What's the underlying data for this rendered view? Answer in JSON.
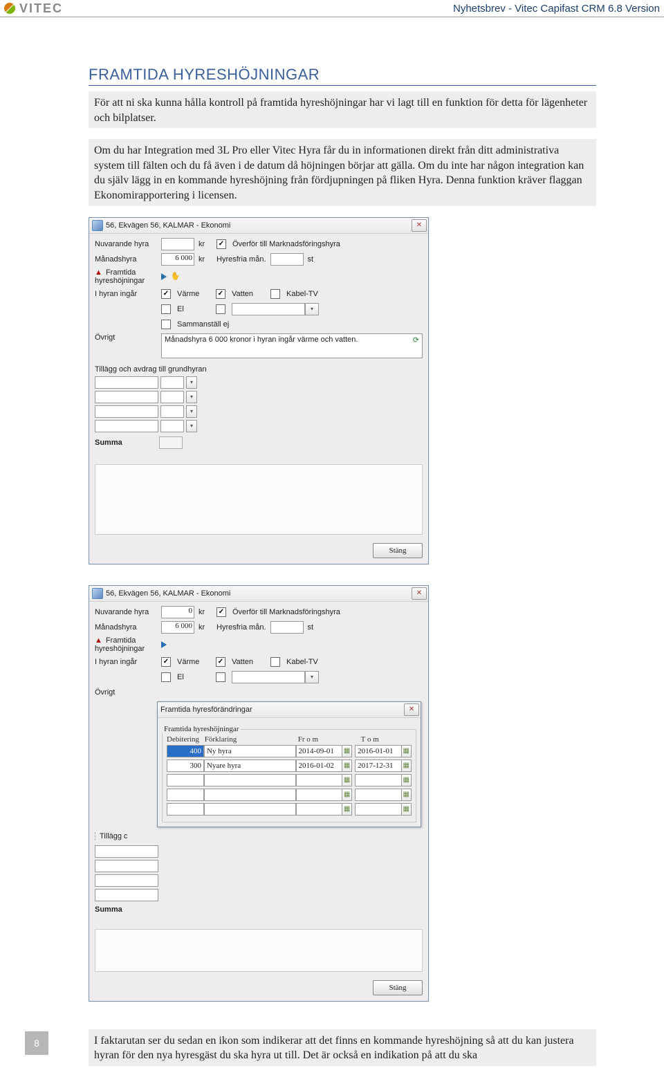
{
  "header": {
    "brand": "VITEC",
    "newsletter_label": "Nyhetsbrev - Vitec Capifast CRM 6.8 Version"
  },
  "article": {
    "section_title": "FRAMTIDA HYRESHÖJNINGAR",
    "p1": "För att ni ska kunna hålla kontroll på framtida hyreshöjningar har vi lagt till en funktion för detta för lägenheter och bilplatser.",
    "p2": "Om du har Integration med 3L Pro eller Vitec Hyra får du in informationen direkt från ditt administrativa system till fälten och du få även i de datum då höjningen börjar att gälla. Om du inte har någon integration kan du själv lägg in en kommande hyreshöjning från fördjupningen på fliken Hyra. Denna funktion kräver flaggan Ekonomirapportering i licensen.",
    "p3": "I faktarutan ser du sedan en ikon som indikerar att det finns en kommande hyreshöjning så att du kan justera hyran för den nya hyresgäst du ska hyra ut till. Det är också en indikation på att du ska"
  },
  "dialog1": {
    "title": "56, Ekvägen 56, KALMAR - Ekonomi",
    "labels": {
      "nuvarande": "Nuvarande hyra",
      "kr": "kr",
      "overfor": "Överför till Marknadsföringshyra",
      "manadshyra": "Månadshyra",
      "manads_value": "6 000",
      "hyresfria": "Hyresfria mån.",
      "st": "st",
      "framtida": "Framtida hyreshöjningar",
      "ihyran": "I hyran ingår",
      "varme": "Värme",
      "vatten": "Vatten",
      "kabeltv": "Kabel-TV",
      "el": "El",
      "sammanstall": "Sammanställ ej",
      "ovrigt": "Övrigt",
      "ovrigt_text": "Månadshyra 6 000 kronor i hyran ingår värme och vatten.",
      "tillagg": "Tillägg och avdrag till grundhyran",
      "summa": "Summa",
      "stang": "Stäng"
    }
  },
  "dialog2": {
    "title": "56, Ekvägen 56, KALMAR - Ekonomi",
    "labels": {
      "nuvarande": "Nuvarande hyra",
      "nuvarande_value": "0",
      "kr": "kr",
      "overfor": "Överför till Marknadsföringshyra",
      "manadshyra": "Månadshyra",
      "manads_value": "6 000",
      "hyresfria": "Hyresfria mån.",
      "st": "st",
      "framtida": "Framtida hyreshöjningar",
      "ihyran": "I hyran ingår",
      "varme": "Värme",
      "vatten": "Vatten",
      "kabeltv": "Kabel-TV",
      "el": "El",
      "ovrigt": "Övrigt",
      "tillaggc": "Tillägg c",
      "summa": "Summa",
      "stang": "Stäng"
    },
    "inner": {
      "title": "Framtida hyresförändringar",
      "fieldset": "Framtida hyreshöjningar",
      "cols": {
        "deb": "Debitering",
        "for": "Förklaring",
        "from": "Fr o m",
        "tom": "T o m"
      },
      "rows": [
        {
          "deb": "400",
          "for": "Ny hyra",
          "from": "2014-09-01",
          "tom": "2016-01-01",
          "sel": true
        },
        {
          "deb": "300",
          "for": "Nyare hyra",
          "from": "2016-01-02",
          "tom": "2017-12-31",
          "sel": false
        }
      ]
    }
  },
  "page_number": "8"
}
